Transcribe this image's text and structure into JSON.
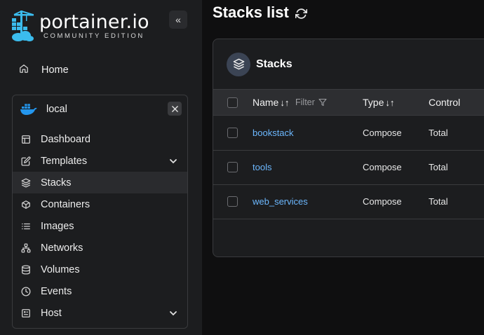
{
  "brand": {
    "name": "portainer.io",
    "edition": "COMMUNITY EDITION"
  },
  "sidebar": {
    "collapse_icon": "«",
    "home_label": "Home",
    "environment": {
      "name": "local",
      "icon": "docker-icon"
    },
    "items": [
      {
        "label": "Dashboard",
        "icon": "dashboard-icon"
      },
      {
        "label": "Templates",
        "icon": "edit-icon",
        "expandable": true
      },
      {
        "label": "Stacks",
        "icon": "layers-icon",
        "active": true
      },
      {
        "label": "Containers",
        "icon": "box-icon"
      },
      {
        "label": "Images",
        "icon": "list-icon"
      },
      {
        "label": "Networks",
        "icon": "network-icon"
      },
      {
        "label": "Volumes",
        "icon": "database-icon"
      },
      {
        "label": "Events",
        "icon": "clock-icon"
      },
      {
        "label": "Host",
        "icon": "host-icon",
        "expandable": true
      }
    ]
  },
  "main": {
    "title": "Stacks list",
    "card": {
      "title": "Stacks",
      "columns": {
        "name": "Name",
        "filter": "Filter",
        "type": "Type",
        "control": "Control"
      },
      "rows": [
        {
          "name": "bookstack",
          "type": "Compose",
          "control": "Total"
        },
        {
          "name": "tools",
          "type": "Compose",
          "control": "Total"
        },
        {
          "name": "web_services",
          "type": "Compose",
          "control": "Total"
        }
      ]
    }
  },
  "colors": {
    "link": "#6cb8ff",
    "sidebar_bg": "#1c1d1f",
    "page_bg": "#0f0f10",
    "docker_blue": "#2496ed"
  }
}
